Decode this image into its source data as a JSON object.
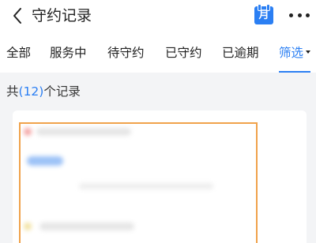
{
  "header": {
    "title": "守约记录",
    "calendar_label": "月"
  },
  "tabs": [
    {
      "label": "全部"
    },
    {
      "label": "服务中"
    },
    {
      "label": "待守约"
    },
    {
      "label": "已守约"
    },
    {
      "label": "已逾期"
    },
    {
      "label": "筛选",
      "active": true
    }
  ],
  "summary": {
    "prefix": "共",
    "count": "(12)",
    "suffix": "个记录"
  },
  "colors": {
    "accent": "#2b7ff3",
    "highlight": "#f0a24b"
  }
}
